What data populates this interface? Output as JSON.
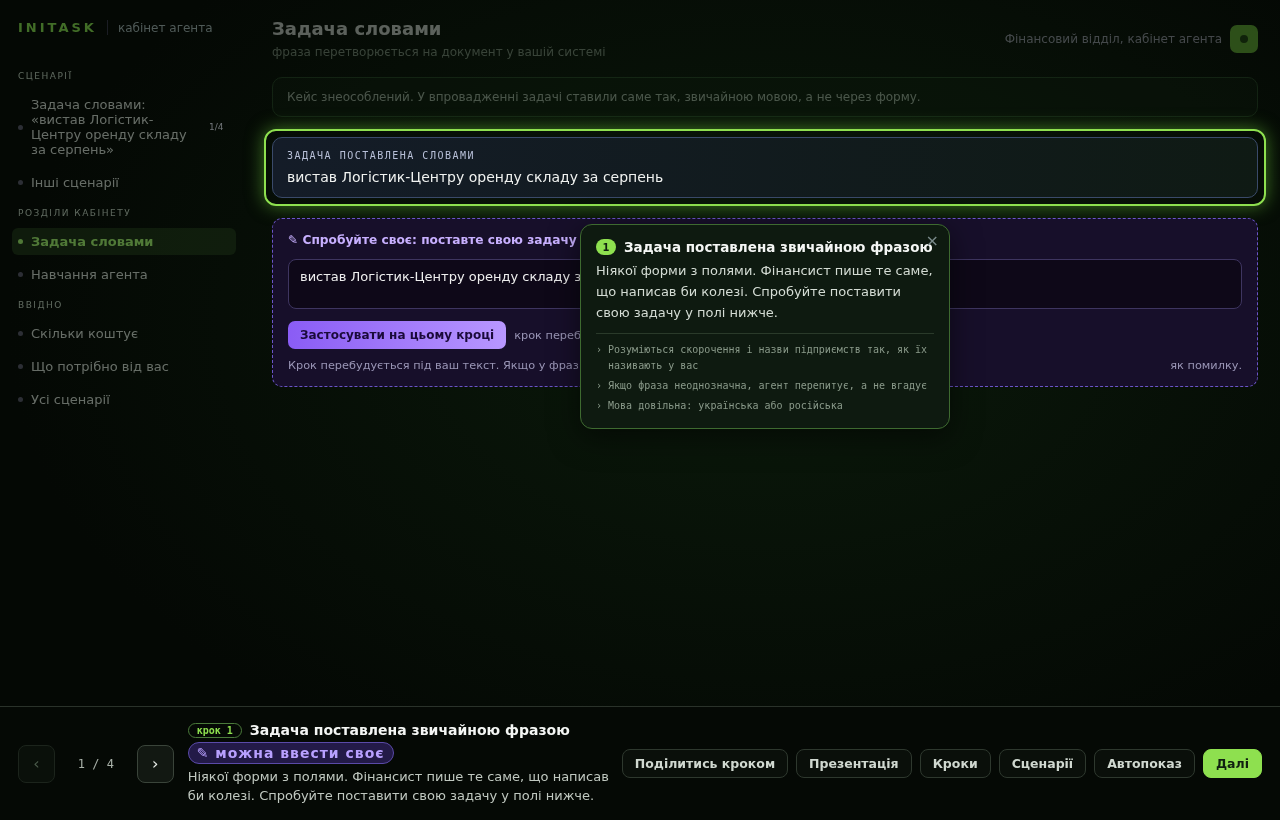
{
  "sidebar": {
    "logo": "INITASK",
    "subtitle": "кабінет агента",
    "sections": [
      {
        "label": "СЦЕНАРІЇ",
        "items": [
          {
            "label": "Задача словами: «вистав Логістик-Центру оренду складу за серпень»",
            "count": "1/4",
            "selected": false
          },
          {
            "label": "Інші сценарії",
            "selected": false
          }
        ]
      },
      {
        "label": "РОЗДІЛИ КАБІНЕТУ",
        "items": [
          {
            "label": "Задача словами",
            "selected": true
          },
          {
            "label": "Навчання агента",
            "selected": false
          }
        ]
      },
      {
        "label": "ВВІДНО",
        "items": [
          {
            "label": "Скільки коштує",
            "selected": false
          },
          {
            "label": "Що потрібно від вас",
            "selected": false
          },
          {
            "label": "Усі сценарії",
            "selected": false
          }
        ]
      }
    ]
  },
  "header": {
    "title": "Задача словами",
    "subtitle": "фраза перетворюється на документ у вашій системі",
    "account": "Фінансовий відділ, кабінет агента"
  },
  "notice": "Кейс знеособлений. У впровадженні задачі ставили саме так, звичайною мовою, а не через форму.",
  "task_card": {
    "label": "ЗАДАЧА ПОСТАВЛЕНА СЛОВАМИ",
    "text": "вистав Логістик-Центру оренду складу за серпень"
  },
  "try_panel": {
    "title": "✎ Спробуйте своє: поставте свою задачу",
    "value": "вистав Логістик-Центру оренду складу з",
    "button": "Застосувати на цьому кроці",
    "button_note": "крок переб",
    "hint_start": "Крок перебудується під ваш текст. Якщо у фраз",
    "hint_end": "як помилку."
  },
  "popover": {
    "number": "1",
    "title": "Задача поставлена звичайною фразою",
    "close": "×",
    "body": "Ніякої форми з полями. Фінансист пише те саме, що написав би колезі. Спробуйте поставити свою задачу у полі нижче.",
    "bullets": [
      "Розуміються скорочення і назви підприємств так, як їх називають у вас",
      "Якщо фраза неоднозначна, агент перепитує, а не вгадує",
      "Мова довільна: українська або російська"
    ],
    "bullet_mark": "›"
  },
  "tour_bar": {
    "prev": {
      "label": "‹",
      "disabled": true
    },
    "counter": "1 / 4",
    "next": {
      "label": "›",
      "disabled": false
    },
    "step_tag": "крок 1",
    "title": "Задача поставлена звичайною фразою",
    "chip": "✎ можна ввести своє",
    "description": "Ніякої форми з полями. Фінансист пише те саме, що написав би колезі. Спробуйте поставити свою задачу у полі нижче.",
    "actions": [
      {
        "label": "Поділитись кроком",
        "kind": "secondary"
      },
      {
        "label": "Презентація",
        "kind": "secondary"
      },
      {
        "label": "Кроки",
        "kind": "secondary"
      },
      {
        "label": "Сценарії",
        "kind": "secondary"
      },
      {
        "label": "Автопоказ",
        "kind": "secondary"
      },
      {
        "label": "Далі",
        "kind": "primary"
      }
    ]
  }
}
